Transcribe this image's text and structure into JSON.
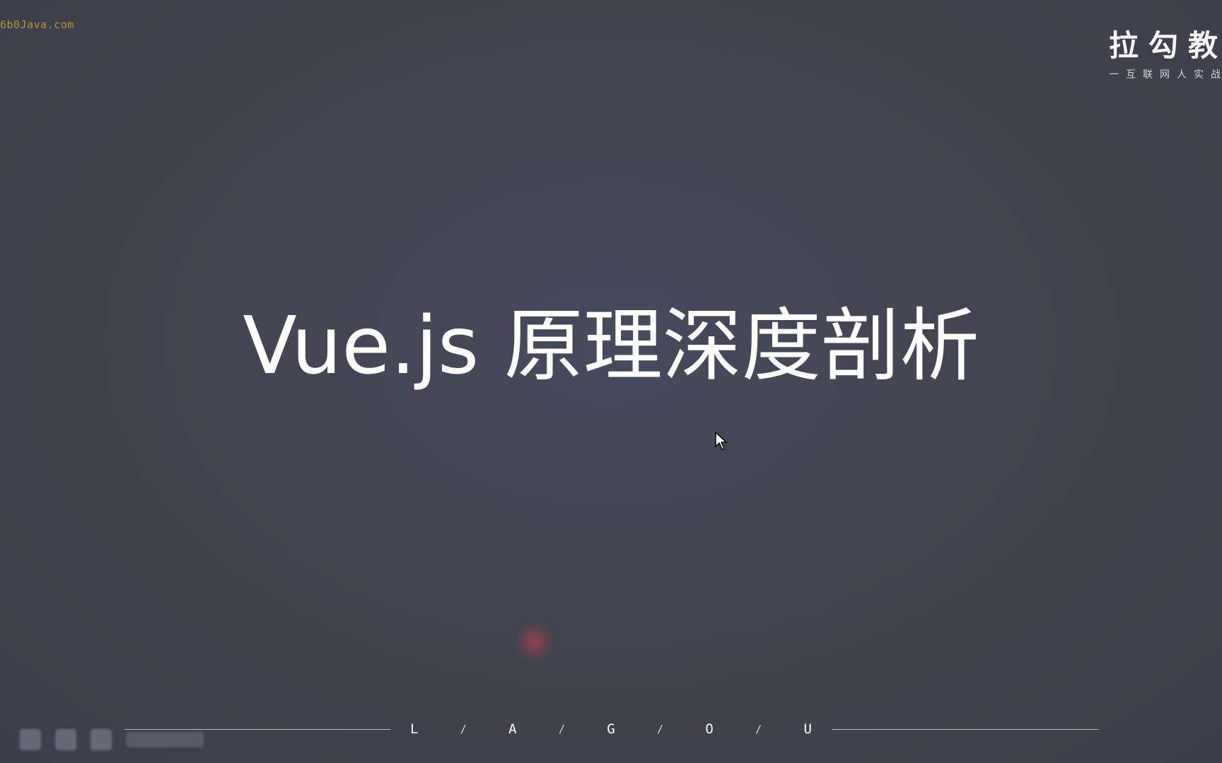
{
  "window": {
    "watermark_text": "6b0Java.com"
  },
  "logo": {
    "name_cn": "拉勾教育",
    "tagline_cn": "一互联网人实战大学"
  },
  "slide": {
    "title": "Vue.js 原理深度剖析"
  },
  "footer": {
    "letters": [
      "L",
      "A",
      "G",
      "O",
      "U"
    ],
    "separator": "/"
  },
  "colors": {
    "background": "#42434f",
    "title_text": "#ffffff",
    "watermark": "#c8a13a",
    "footer_line": "#b9bac4"
  },
  "icons": {
    "cursor": "mouse-pointer-icon",
    "taskbar": [
      "app-icon",
      "app-icon",
      "app-icon",
      "taskbar-label"
    ]
  }
}
